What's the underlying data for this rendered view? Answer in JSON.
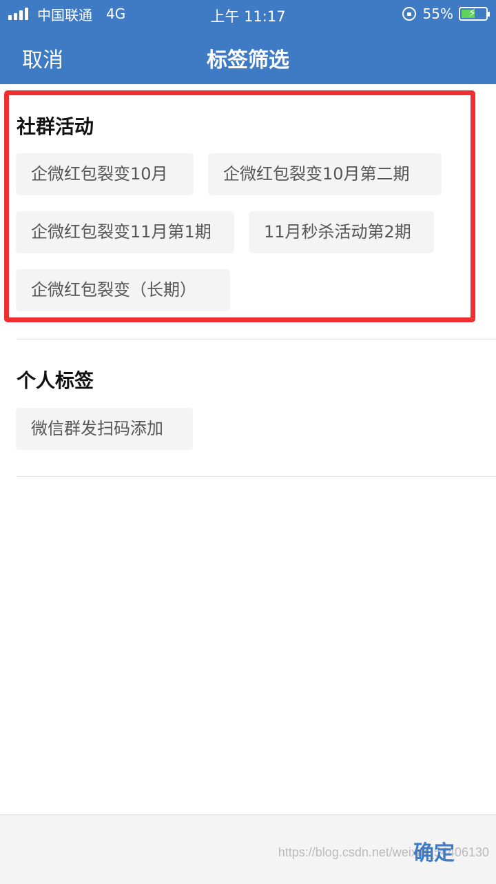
{
  "status_bar": {
    "carrier": "中国联通",
    "network": "4G",
    "time": "上午 11:17",
    "battery_percent": "55%",
    "battery_level": 0.55
  },
  "nav": {
    "cancel_label": "取消",
    "title": "标签筛选"
  },
  "sections": [
    {
      "title": "社群活动",
      "tags": [
        "企微红包裂变10月",
        "企微红包裂变10月第二期",
        "企微红包裂变11月第1期",
        "11月秒杀活动第2期",
        "企微红包裂变（长期）"
      ]
    },
    {
      "title": "个人标签",
      "tags": [
        "微信群发扫码添加"
      ]
    }
  ],
  "footer": {
    "confirm_label": "确定",
    "watermark": "https://blog.csdn.net/weixin_54406130"
  },
  "colors": {
    "primary": "#3f7bc4",
    "highlight": "#ee2f31",
    "tag_bg": "#f4f4f4"
  }
}
